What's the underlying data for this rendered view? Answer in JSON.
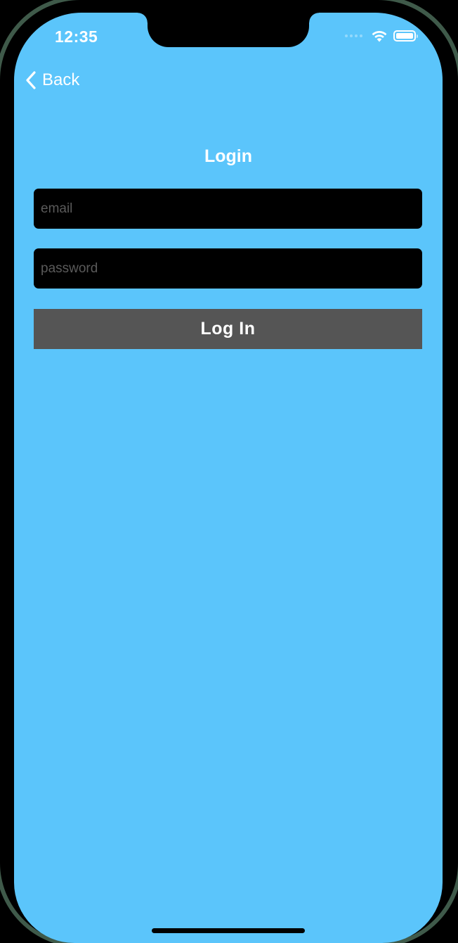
{
  "status_bar": {
    "time": "12:35",
    "icons": [
      "signal-icon",
      "wifi-icon",
      "battery-icon"
    ]
  },
  "nav": {
    "back_label": "Back",
    "back_icon": "chevron-left-icon"
  },
  "login": {
    "title": "Login",
    "email_placeholder": "email",
    "email_value": "",
    "password_placeholder": "password",
    "password_value": "",
    "submit_label": "Log In"
  },
  "colors": {
    "background": "#5bc5fb",
    "field": "#000000",
    "button": "#555555",
    "text": "#ffffff"
  }
}
